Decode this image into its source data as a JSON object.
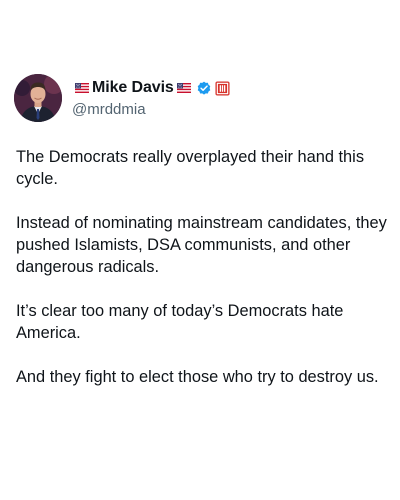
{
  "author": {
    "display_name": "Mike Davis",
    "handle": "@mrddmia",
    "icons": [
      "us-flag-icon",
      "us-flag-icon",
      "verified-badge-icon",
      "affiliation-badge-icon"
    ],
    "colors": {
      "verified": "#1d9bf0",
      "affiliation": "#d6312a",
      "handle": "#536471",
      "text": "#0f1419"
    }
  },
  "post": {
    "paragraphs": [
      "The Democrats really overplayed their hand this cycle.",
      "Instead of nominating mainstream candidates, they pushed Islamists, DSA communists, and other dangerous radicals.",
      "It’s clear too many of today’s Democrats hate America.",
      "And they fight to elect those who try to destroy us."
    ]
  }
}
